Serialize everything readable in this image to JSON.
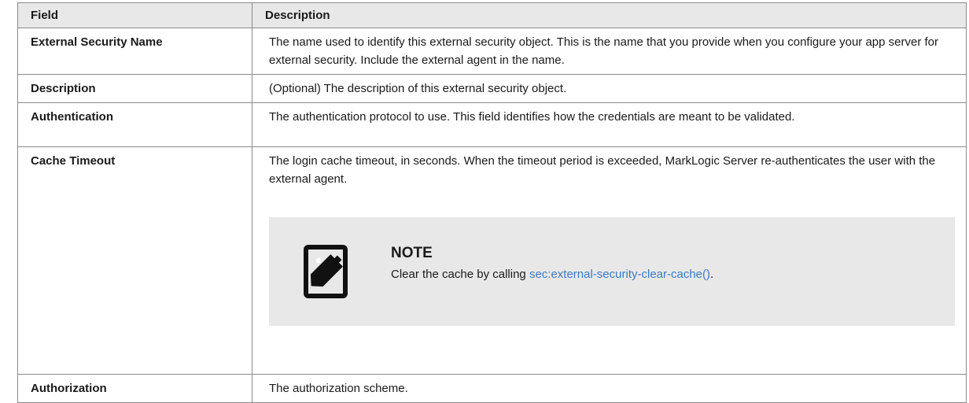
{
  "table": {
    "headers": {
      "field": "Field",
      "description": "Description"
    },
    "rows": [
      {
        "field": "External Security Name",
        "description": "The name used to identify this external security object. This is the name that you provide when you configure your app server for external security. Include the external agent in the name."
      },
      {
        "field": "Description",
        "description": "(Optional) The description of this external security object."
      },
      {
        "field": "Authentication",
        "description": "The authentication protocol to use. This field identifies how the credentials are meant to be validated."
      },
      {
        "field": "Cache Timeout",
        "description": "The login cache timeout, in seconds. When the timeout period is exceeded, MarkLogic Server re-authenticates the user with the external agent.",
        "note": {
          "icon": "note-icon",
          "title": "NOTE",
          "text": "Clear the cache by calling ",
          "link": "sec:external-security-clear-cache()",
          "after": "."
        }
      },
      {
        "field": "Authorization",
        "description": "The authorization scheme."
      }
    ]
  },
  "colors": {
    "header_bg": "#e8e8e8",
    "note_bg": "#e8e8e8",
    "link": "#3d7ac2",
    "border": "#8a8a8a"
  }
}
